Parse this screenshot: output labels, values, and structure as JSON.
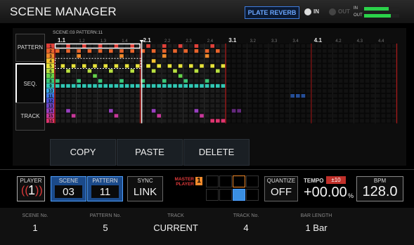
{
  "header": {
    "title": "SCENE MANAGER",
    "effect": "PLATE REVERB",
    "in_label": "IN",
    "out_label": "OUT",
    "meter_in_label": "IN",
    "meter_out_label": "OUT",
    "meter_in_level": 0.7,
    "meter_out_level": 0.75
  },
  "side": {
    "pattern": "PATTERN",
    "seq": "SEQ.",
    "track": "TRACK"
  },
  "grid": {
    "scene_info": "SCENE:03  PATTERN:11",
    "bar_labels": [
      "1.1",
      "1.2",
      "1.3",
      "1.4",
      "2.1",
      "2.2",
      "2.3",
      "2.4",
      "3.1",
      "3.2",
      "3.3",
      "3.4",
      "4.1",
      "4.2",
      "4.3",
      "4.4"
    ],
    "track_numbers": [
      "1",
      "2",
      "3",
      "4",
      "5",
      "6",
      "7",
      "8",
      "9",
      "10",
      "11",
      "12",
      "13",
      "14",
      "15",
      "16"
    ],
    "track_colors": [
      "#e0403a",
      "#e8642c",
      "#f08a2c",
      "#f4c430",
      "#e8e43a",
      "#b8e040",
      "#64d24a",
      "#3cc878",
      "#30c8b4",
      "#3aa8e8",
      "#3a78e8",
      "#4a50d8",
      "#7048c8",
      "#9a40c0",
      "#c8389a",
      "#e03470"
    ]
  },
  "actions": {
    "copy": "COPY",
    "paste": "PASTE",
    "delete": "DELETE"
  },
  "player": {
    "label": "PLAYER",
    "value": "1"
  },
  "scene": {
    "label": "SCENE",
    "value": "03"
  },
  "pattern": {
    "label": "PATTERN",
    "value": "11"
  },
  "sync": {
    "label": "SYNC",
    "value": "LINK"
  },
  "master": {
    "label": "MASTER\nPLAYER",
    "value": "1"
  },
  "quantize": {
    "label": "QUANTIZE",
    "value": "OFF"
  },
  "tempo": {
    "label": "TEMPO",
    "range": "±10",
    "value": "+00.00",
    "unit": "%"
  },
  "bpm": {
    "label": "BPM",
    "value": "128.0"
  },
  "fields": [
    {
      "label": "SCENE No.",
      "value": "1"
    },
    {
      "label": "PATTERN No.",
      "value": "5"
    },
    {
      "label": "TRACK",
      "value": "CURRENT"
    },
    {
      "label": "TRACK No.",
      "value": "4"
    },
    {
      "label": "BAR LENGTH",
      "value": "1 Bar"
    }
  ]
}
